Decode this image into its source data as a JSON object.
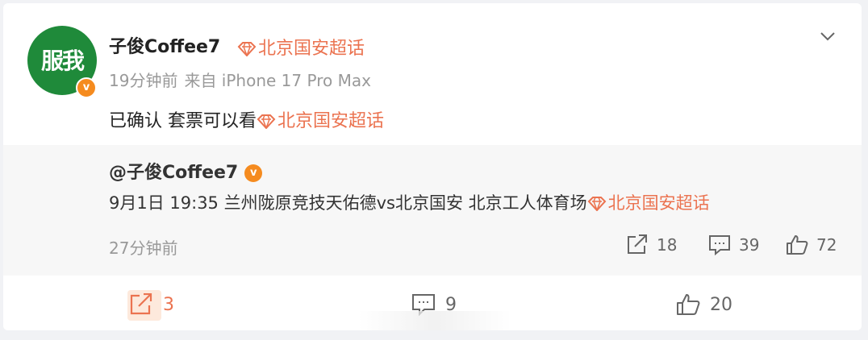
{
  "post": {
    "avatar_text": "服我",
    "username": "子俊Coffee7",
    "topic": "北京国安超话",
    "time": "19分钟前",
    "source": "来自 iPhone 17 Pro Max",
    "content_text": "已确认 套票可以看",
    "content_topic": "北京国安超话"
  },
  "repost": {
    "user": "@子俊Coffee7",
    "text": "9月1日 19:35 兰州陇原竞技天佑德vs北京国安 北京工人体育场",
    "topic": "北京国安超话",
    "time": "27分钟前",
    "stats": {
      "reposts": "18",
      "comments": "39",
      "likes": "72"
    }
  },
  "actions": {
    "repost_count": "3",
    "comment_count": "9",
    "like_count": "20"
  },
  "colors": {
    "accent": "#eb7350",
    "verified": "#f58b1f",
    "avatar_bg": "#1f8a3a"
  }
}
